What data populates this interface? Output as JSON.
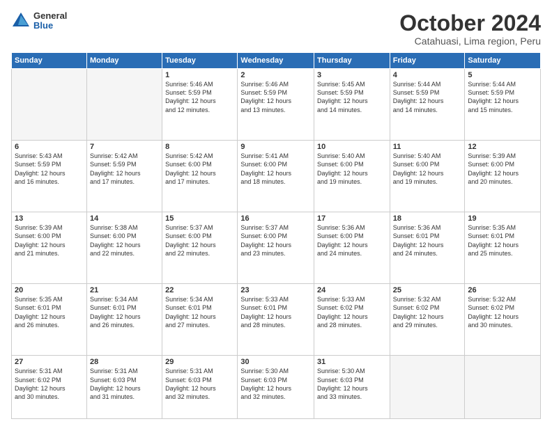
{
  "logo": {
    "general": "General",
    "blue": "Blue"
  },
  "title": "October 2024",
  "subtitle": "Catahuasi, Lima region, Peru",
  "days_header": [
    "Sunday",
    "Monday",
    "Tuesday",
    "Wednesday",
    "Thursday",
    "Friday",
    "Saturday"
  ],
  "weeks": [
    [
      {
        "day": "",
        "info": "",
        "empty": true
      },
      {
        "day": "",
        "info": "",
        "empty": true
      },
      {
        "day": "1",
        "info": "Sunrise: 5:46 AM\nSunset: 5:59 PM\nDaylight: 12 hours\nand 12 minutes."
      },
      {
        "day": "2",
        "info": "Sunrise: 5:46 AM\nSunset: 5:59 PM\nDaylight: 12 hours\nand 13 minutes."
      },
      {
        "day": "3",
        "info": "Sunrise: 5:45 AM\nSunset: 5:59 PM\nDaylight: 12 hours\nand 14 minutes."
      },
      {
        "day": "4",
        "info": "Sunrise: 5:44 AM\nSunset: 5:59 PM\nDaylight: 12 hours\nand 14 minutes."
      },
      {
        "day": "5",
        "info": "Sunrise: 5:44 AM\nSunset: 5:59 PM\nDaylight: 12 hours\nand 15 minutes."
      }
    ],
    [
      {
        "day": "6",
        "info": "Sunrise: 5:43 AM\nSunset: 5:59 PM\nDaylight: 12 hours\nand 16 minutes."
      },
      {
        "day": "7",
        "info": "Sunrise: 5:42 AM\nSunset: 5:59 PM\nDaylight: 12 hours\nand 17 minutes."
      },
      {
        "day": "8",
        "info": "Sunrise: 5:42 AM\nSunset: 6:00 PM\nDaylight: 12 hours\nand 17 minutes."
      },
      {
        "day": "9",
        "info": "Sunrise: 5:41 AM\nSunset: 6:00 PM\nDaylight: 12 hours\nand 18 minutes."
      },
      {
        "day": "10",
        "info": "Sunrise: 5:40 AM\nSunset: 6:00 PM\nDaylight: 12 hours\nand 19 minutes."
      },
      {
        "day": "11",
        "info": "Sunrise: 5:40 AM\nSunset: 6:00 PM\nDaylight: 12 hours\nand 19 minutes."
      },
      {
        "day": "12",
        "info": "Sunrise: 5:39 AM\nSunset: 6:00 PM\nDaylight: 12 hours\nand 20 minutes."
      }
    ],
    [
      {
        "day": "13",
        "info": "Sunrise: 5:39 AM\nSunset: 6:00 PM\nDaylight: 12 hours\nand 21 minutes."
      },
      {
        "day": "14",
        "info": "Sunrise: 5:38 AM\nSunset: 6:00 PM\nDaylight: 12 hours\nand 22 minutes."
      },
      {
        "day": "15",
        "info": "Sunrise: 5:37 AM\nSunset: 6:00 PM\nDaylight: 12 hours\nand 22 minutes."
      },
      {
        "day": "16",
        "info": "Sunrise: 5:37 AM\nSunset: 6:00 PM\nDaylight: 12 hours\nand 23 minutes."
      },
      {
        "day": "17",
        "info": "Sunrise: 5:36 AM\nSunset: 6:00 PM\nDaylight: 12 hours\nand 24 minutes."
      },
      {
        "day": "18",
        "info": "Sunrise: 5:36 AM\nSunset: 6:01 PM\nDaylight: 12 hours\nand 24 minutes."
      },
      {
        "day": "19",
        "info": "Sunrise: 5:35 AM\nSunset: 6:01 PM\nDaylight: 12 hours\nand 25 minutes."
      }
    ],
    [
      {
        "day": "20",
        "info": "Sunrise: 5:35 AM\nSunset: 6:01 PM\nDaylight: 12 hours\nand 26 minutes."
      },
      {
        "day": "21",
        "info": "Sunrise: 5:34 AM\nSunset: 6:01 PM\nDaylight: 12 hours\nand 26 minutes."
      },
      {
        "day": "22",
        "info": "Sunrise: 5:34 AM\nSunset: 6:01 PM\nDaylight: 12 hours\nand 27 minutes."
      },
      {
        "day": "23",
        "info": "Sunrise: 5:33 AM\nSunset: 6:01 PM\nDaylight: 12 hours\nand 28 minutes."
      },
      {
        "day": "24",
        "info": "Sunrise: 5:33 AM\nSunset: 6:02 PM\nDaylight: 12 hours\nand 28 minutes."
      },
      {
        "day": "25",
        "info": "Sunrise: 5:32 AM\nSunset: 6:02 PM\nDaylight: 12 hours\nand 29 minutes."
      },
      {
        "day": "26",
        "info": "Sunrise: 5:32 AM\nSunset: 6:02 PM\nDaylight: 12 hours\nand 30 minutes."
      }
    ],
    [
      {
        "day": "27",
        "info": "Sunrise: 5:31 AM\nSunset: 6:02 PM\nDaylight: 12 hours\nand 30 minutes."
      },
      {
        "day": "28",
        "info": "Sunrise: 5:31 AM\nSunset: 6:03 PM\nDaylight: 12 hours\nand 31 minutes."
      },
      {
        "day": "29",
        "info": "Sunrise: 5:31 AM\nSunset: 6:03 PM\nDaylight: 12 hours\nand 32 minutes."
      },
      {
        "day": "30",
        "info": "Sunrise: 5:30 AM\nSunset: 6:03 PM\nDaylight: 12 hours\nand 32 minutes."
      },
      {
        "day": "31",
        "info": "Sunrise: 5:30 AM\nSunset: 6:03 PM\nDaylight: 12 hours\nand 33 minutes."
      },
      {
        "day": "",
        "info": "",
        "empty": true
      },
      {
        "day": "",
        "info": "",
        "empty": true
      }
    ]
  ]
}
